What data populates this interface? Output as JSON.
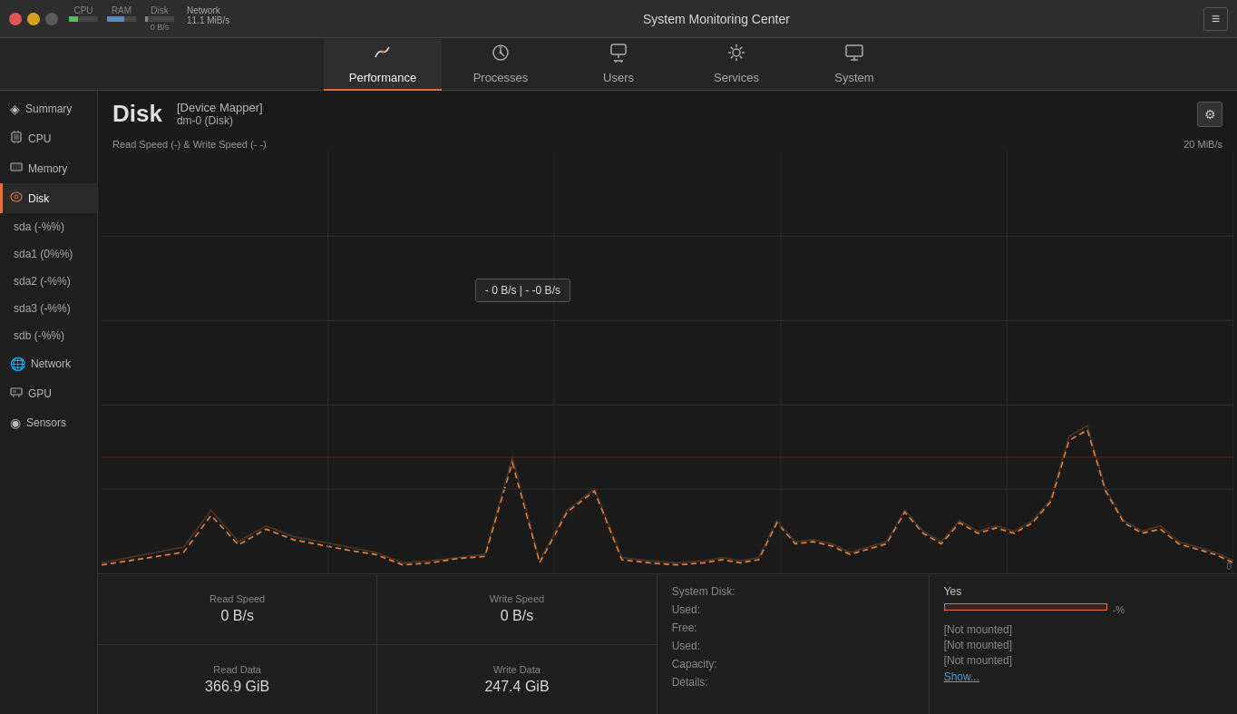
{
  "app": {
    "title": "System Monitoring Center"
  },
  "titlebar": {
    "cpu_label": "CPU",
    "ram_label": "RAM",
    "disk_label": "Disk",
    "net_label": "Network",
    "net_value": "11.1 MiB/s",
    "disk_bytes": "0 B/s",
    "menu_icon": "≡"
  },
  "tabs": [
    {
      "id": "performance",
      "label": "Performance",
      "icon": "📈",
      "active": true
    },
    {
      "id": "processes",
      "label": "Processes",
      "icon": "⚙",
      "active": false
    },
    {
      "id": "users",
      "label": "Users",
      "icon": "🖱",
      "active": false
    },
    {
      "id": "services",
      "label": "Services",
      "icon": "⚙",
      "active": false
    },
    {
      "id": "system",
      "label": "System",
      "icon": "🖥",
      "active": false
    }
  ],
  "sidebar": {
    "items": [
      {
        "id": "summary",
        "label": "Summary",
        "icon": "◈",
        "active": false
      },
      {
        "id": "cpu",
        "label": "CPU",
        "icon": "▦",
        "active": false
      },
      {
        "id": "memory",
        "label": "Memory",
        "icon": "▤",
        "active": false
      },
      {
        "id": "disk",
        "label": "Disk",
        "icon": "▣",
        "active": true
      },
      {
        "id": "sda",
        "label": "sda",
        "sub_label": "(-%%)",
        "active": false
      },
      {
        "id": "sda1",
        "label": "sda1",
        "sub_label": "(0%%)",
        "active": false
      },
      {
        "id": "sda2",
        "label": "sda2",
        "sub_label": "(-%%)",
        "active": false
      },
      {
        "id": "sda3",
        "label": "sda3",
        "sub_label": "(-%%)",
        "active": false
      },
      {
        "id": "sdb",
        "label": "sdb",
        "sub_label": "(-%%)",
        "active": false
      },
      {
        "id": "network",
        "label": "Network",
        "icon": "🌐",
        "active": false
      },
      {
        "id": "gpu",
        "label": "GPU",
        "icon": "▦",
        "active": false
      },
      {
        "id": "sensors",
        "label": "Sensors",
        "icon": "◉",
        "active": false
      }
    ]
  },
  "disk_view": {
    "title": "Disk",
    "device_mapper": "[Device Mapper]",
    "device_name": "dm-0 (Disk)",
    "chart_label": "Read Speed (-) & Write Speed (-  -)",
    "chart_max": "20 MiB/s",
    "chart_min": "0",
    "tooltip": "- 0 B/s  |  - -0 B/s",
    "read_speed_label": "Read Speed",
    "read_speed_value": "0 B/s",
    "write_speed_label": "Write Speed",
    "write_speed_value": "0 B/s",
    "read_data_label": "Read Data",
    "read_data_value": "366.9 GiB",
    "write_data_label": "Write Data",
    "write_data_value": "247.4 GiB",
    "system_disk_label": "System Disk:",
    "used_label": "Used:",
    "free_label": "Free:",
    "used2_label": "Used:",
    "capacity_label": "Capacity:",
    "details_label": "Details:",
    "yes_label": "Yes",
    "bar_suffix": "-%",
    "not_mounted_1": "[Not mounted]",
    "not_mounted_2": "[Not mounted]",
    "not_mounted_3": "[Not mounted]",
    "show_more": "Show..."
  }
}
